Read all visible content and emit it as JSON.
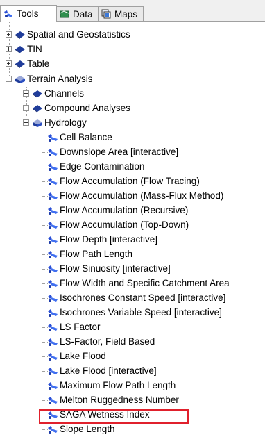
{
  "tabs": [
    {
      "label": "Tools",
      "icon": "tools-icon",
      "active": true
    },
    {
      "label": "Data",
      "icon": "data-icon",
      "active": false
    },
    {
      "label": "Maps",
      "icon": "maps-icon",
      "active": false
    }
  ],
  "tree": {
    "groups": [
      {
        "label": "Spatial and Geostatistics",
        "icon": "book-icon",
        "state": "collapsed"
      },
      {
        "label": "TIN",
        "icon": "book-icon",
        "state": "collapsed"
      },
      {
        "label": "Table",
        "icon": "book-icon",
        "state": "collapsed"
      },
      {
        "label": "Terrain Analysis",
        "icon": "book-open-icon",
        "state": "expanded"
      }
    ],
    "terrain_children": [
      {
        "label": "Channels",
        "icon": "book-icon",
        "state": "collapsed"
      },
      {
        "label": "Compound Analyses",
        "icon": "book-icon",
        "state": "collapsed"
      },
      {
        "label": "Hydrology",
        "icon": "book-open-icon",
        "state": "expanded"
      }
    ],
    "hydrology_tools": [
      "Cell Balance",
      "Downslope Area [interactive]",
      "Edge Contamination",
      "Flow Accumulation (Flow Tracing)",
      "Flow Accumulation (Mass-Flux Method)",
      "Flow Accumulation (Recursive)",
      "Flow Accumulation (Top-Down)",
      "Flow Depth [interactive]",
      "Flow Path Length",
      "Flow Sinuosity [interactive]",
      "Flow Width and Specific Catchment Area",
      "Isochrones Constant Speed [interactive]",
      "Isochrones Variable Speed [interactive]",
      "LS Factor",
      "LS-Factor, Field Based",
      "Lake Flood",
      "Lake Flood [interactive]",
      "Maximum Flow Path Length",
      "Melton Ruggedness Number",
      "SAGA Wetness Index",
      "Slope Length"
    ],
    "highlighted_item": "SAGA Wetness Index",
    "highlight_color": "#e0202c"
  }
}
